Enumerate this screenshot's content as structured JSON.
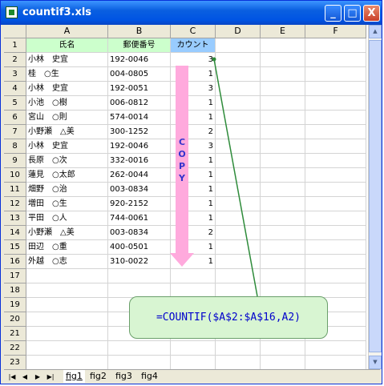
{
  "window": {
    "title": "countif3.xls",
    "buttons": [
      "_",
      "□",
      "X"
    ]
  },
  "columns": [
    "A",
    "B",
    "C",
    "D",
    "E",
    "F"
  ],
  "rows": [
    {
      "n": "1",
      "a": "氏名",
      "b": "郵便番号",
      "c": "カウント"
    },
    {
      "n": "2",
      "a": "小林　史宜",
      "b": "192-0046",
      "c": "3"
    },
    {
      "n": "3",
      "a": "桂　○生",
      "b": "004-0805",
      "c": "1"
    },
    {
      "n": "4",
      "a": "小林　史宜",
      "b": "192-0051",
      "c": "3"
    },
    {
      "n": "5",
      "a": "小池　○樹",
      "b": "006-0812",
      "c": "1"
    },
    {
      "n": "6",
      "a": "宮山　○則",
      "b": "574-0014",
      "c": "1"
    },
    {
      "n": "7",
      "a": "小野瀬　△美",
      "b": "300-1252",
      "c": "2"
    },
    {
      "n": "8",
      "a": "小林　史宜",
      "b": "192-0046",
      "c": "3"
    },
    {
      "n": "9",
      "a": "長原　○次",
      "b": "332-0016",
      "c": "1"
    },
    {
      "n": "10",
      "a": "蓮見　○太郎",
      "b": "262-0044",
      "c": "1"
    },
    {
      "n": "11",
      "a": "畑野　○治",
      "b": "003-0834",
      "c": "1"
    },
    {
      "n": "12",
      "a": "増田　○生",
      "b": "920-2152",
      "c": "1"
    },
    {
      "n": "13",
      "a": "平田　○人",
      "b": "744-0061",
      "c": "1"
    },
    {
      "n": "14",
      "a": "小野瀬　△美",
      "b": "003-0834",
      "c": "2"
    },
    {
      "n": "15",
      "a": "田辺　○重",
      "b": "400-0501",
      "c": "1"
    },
    {
      "n": "16",
      "a": "外越　○志",
      "b": "310-0022",
      "c": "1"
    },
    {
      "n": "17",
      "a": "",
      "b": "",
      "c": ""
    },
    {
      "n": "18",
      "a": "",
      "b": "",
      "c": ""
    },
    {
      "n": "19",
      "a": "",
      "b": "",
      "c": ""
    },
    {
      "n": "20",
      "a": "",
      "b": "",
      "c": ""
    },
    {
      "n": "21",
      "a": "",
      "b": "",
      "c": ""
    },
    {
      "n": "22",
      "a": "",
      "b": "",
      "c": ""
    },
    {
      "n": "23",
      "a": "",
      "b": "",
      "c": ""
    }
  ],
  "annotation": {
    "copy_text": "COPY",
    "formula": "=COUNTIF($A$2:$A$16,A2)",
    "arrow_color": "#ffaadd",
    "line_color": "#2e8b3a"
  },
  "sheet_tabs": [
    {
      "label": "fig1",
      "active": true
    },
    {
      "label": "fig2",
      "active": false
    },
    {
      "label": "fig3",
      "active": false
    },
    {
      "label": "fig4",
      "active": false
    }
  ],
  "nav_buttons": [
    "|◀",
    "◀",
    "▶",
    "▶|"
  ],
  "scroll_icons": {
    "up": "▲",
    "down": "▼"
  }
}
